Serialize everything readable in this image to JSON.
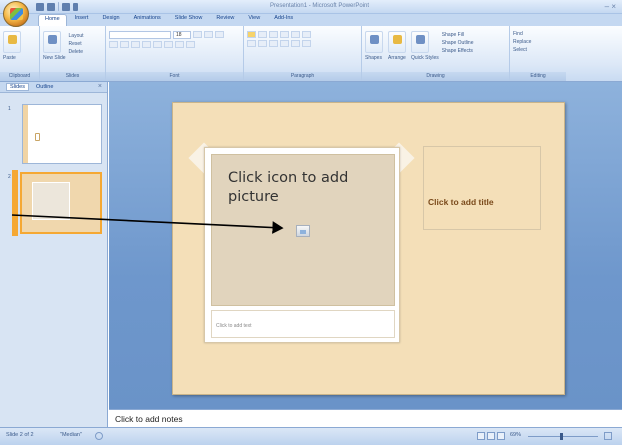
{
  "window": {
    "title": "Presentation1 - Microsoft PowerPoint",
    "controls": "– ×"
  },
  "tabs": [
    {
      "label": "Home",
      "active": true
    },
    {
      "label": "Insert"
    },
    {
      "label": "Design"
    },
    {
      "label": "Animations"
    },
    {
      "label": "Slide Show"
    },
    {
      "label": "Review"
    },
    {
      "label": "View"
    },
    {
      "label": "Add-Ins"
    }
  ],
  "ribbon": {
    "groups": {
      "clipboard": {
        "label": "Clipboard",
        "paste": "Paste"
      },
      "slides": {
        "label": "Slides",
        "new_slide": "New Slide",
        "layout": "Layout",
        "reset": "Reset",
        "delete": "Delete"
      },
      "font": {
        "label": "Font",
        "size": "18"
      },
      "paragraph": {
        "label": "Paragraph"
      },
      "drawing": {
        "label": "Drawing",
        "shapes": "Shapes",
        "arrange": "Arrange",
        "quick_styles": "Quick Styles",
        "shape_fill": "Shape Fill",
        "shape_outline": "Shape Outline",
        "shape_effects": "Shape Effects"
      },
      "editing": {
        "label": "Editing",
        "find": "Find",
        "replace": "Replace",
        "select": "Select"
      }
    }
  },
  "left_panel": {
    "tabs": [
      {
        "label": "Slides",
        "active": true
      },
      {
        "label": "Outline"
      }
    ],
    "close": "×",
    "thumbnails": [
      {
        "number": "1"
      },
      {
        "number": "2",
        "selected": true
      }
    ]
  },
  "slide": {
    "picture_placeholder": "Click icon to add picture",
    "caption_placeholder": "Click to add text",
    "title_placeholder": "Click to add title"
  },
  "notes": {
    "placeholder": "Click to add notes"
  },
  "status_bar": {
    "slide_indicator": "Slide 2 of 2",
    "theme": "\"Median\"",
    "zoom": "69%"
  },
  "colors": {
    "ribbon_blue": "#c4d8f1",
    "slide_background": "#f4dfb8",
    "selected_thumbnail": "#f5a833",
    "workspace_blue": "#6e97cc"
  }
}
